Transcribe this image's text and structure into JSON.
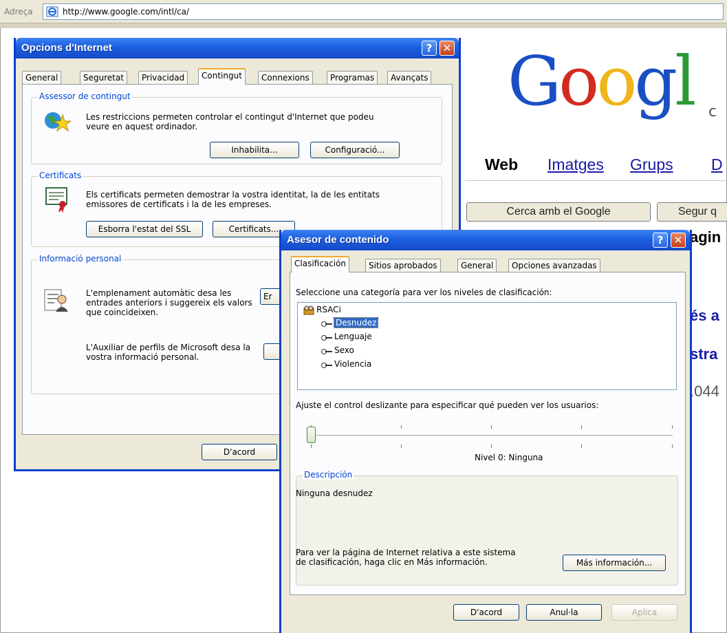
{
  "browser": {
    "address_label": "Adreça",
    "url": "http://www.google.com/intl/ca/"
  },
  "google": {
    "logo": "Googl",
    "subtitle": "c",
    "nav": [
      "Web",
      "Imatges",
      "Grups",
      "D"
    ],
    "search_button": "Cerca amb el Google",
    "lucky_button": "Segur q",
    "snippet1": "agin",
    "snippet2": "és a",
    "snippet3": "stra",
    "snippet4": ".044"
  },
  "internet_options": {
    "title": "Opcions d'Internet",
    "tabs": [
      "General",
      "Seguretat",
      "Privacidad",
      "Contingut",
      "Connexions",
      "Programas",
      "Avançats"
    ],
    "active_tab": "Contingut",
    "content_advisor": {
      "label": "Assessor de contingut",
      "text": "Les restriccions permeten controlar el contingut d'Internet que podeu veure en aquest ordinador.",
      "disable_button": "Inhabilita...",
      "settings_button": "Configuració..."
    },
    "certificates": {
      "label": "Certificats",
      "text": "Els certificats permeten demostrar la vostra identitat, la de les entitats emissores de certificats i la de les empreses.",
      "clear_ssl_button": "Esborra l'estat del SSL",
      "certificates_button": "Certificats..."
    },
    "personal_info": {
      "label": "Informació personal",
      "autocomplete_text": "L'emplenament automàtic desa les entrades anteriors i suggereix els valors que coincideixen.",
      "autocomplete_button": "Er",
      "profile_text": "L'Auxiliar de perfils de Microsoft desa la vostra informació personal."
    },
    "ok_button": "D'acord"
  },
  "content_advisor_dialog": {
    "title": "Asesor de contenido",
    "tabs": [
      "Clasificación",
      "Sitios aprobados",
      "General",
      "Opciones avanzadas"
    ],
    "active_tab": "Clasificación",
    "category_prompt": "Seleccione una categoría para ver los niveles de clasificación:",
    "tree_root": "RSACi",
    "tree_items": [
      "Desnudez",
      "Lenguaje",
      "Sexo",
      "Violencia"
    ],
    "selected_item": "Desnudez",
    "slider_prompt": "Ajuste el control deslizante para especificar qué pueden ver los usuarios:",
    "slider_level": 0,
    "level_text": "Nivel 0:  Ninguna",
    "description_label": "Descripción",
    "description_text": "Ninguna desnudez",
    "more_info_text": "Para ver la página de Internet relativa a este sistema de clasificación, haga clic en Más información.",
    "more_info_button": "Más información...",
    "ok_button": "D'acord",
    "cancel_button": "Anul·la",
    "apply_button": "Aplica"
  },
  "colors": {
    "titlebar": "#1b5fe0",
    "dialog_bg": "#ece9d8",
    "google_blue": "#1a1aa6",
    "selection": "#316ac5"
  }
}
